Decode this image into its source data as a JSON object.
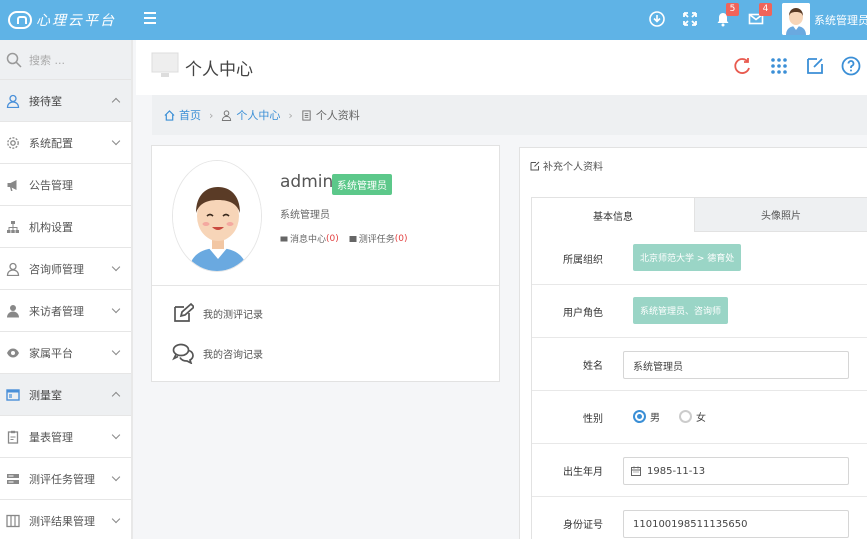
{
  "topbar": {
    "logo_text": "心理云平台",
    "username": "系统管理员",
    "bell_count": "5",
    "mail_count": "4"
  },
  "sidebar": {
    "search_placeholder": "搜索 ...",
    "items": [
      {
        "label": "接待室",
        "icon": "user-outline-icon",
        "group": true,
        "chevron": "up"
      },
      {
        "label": "系统配置",
        "icon": "gear-icon",
        "group": false,
        "chevron": "down"
      },
      {
        "label": "公告管理",
        "icon": "megaphone-icon",
        "group": false,
        "chevron": ""
      },
      {
        "label": "机构设置",
        "icon": "org-chart-icon",
        "group": false,
        "chevron": ""
      },
      {
        "label": "咨询师管理",
        "icon": "user-outline-icon",
        "group": false,
        "chevron": "down"
      },
      {
        "label": "来访者管理",
        "icon": "user-solid-icon",
        "group": false,
        "chevron": "down"
      },
      {
        "label": "家属平台",
        "icon": "eye-icon",
        "group": false,
        "chevron": "down"
      },
      {
        "label": "测量室",
        "icon": "window-icon",
        "group": true,
        "chevron": "up"
      },
      {
        "label": "量表管理",
        "icon": "clipboard-icon",
        "group": false,
        "chevron": "down"
      },
      {
        "label": "测评任务管理",
        "icon": "server-icon",
        "group": false,
        "chevron": "down"
      },
      {
        "label": "测评结果管理",
        "icon": "columns-icon",
        "group": false,
        "chevron": "down"
      }
    ]
  },
  "page": {
    "title": "个人中心"
  },
  "breadcrumb": {
    "home": "首页",
    "center": "个人中心",
    "current": "个人资料"
  },
  "profile": {
    "username": "admin",
    "role_badge": "系统管理员",
    "role_text": "系统管理员",
    "message_label": "消息中心",
    "message_count": "(0)",
    "task_label": "测评任务",
    "task_count": "(0)",
    "record_assess": "我的测评记录",
    "record_consult": "我的咨询记录"
  },
  "panel": {
    "heading": "补充个人资料",
    "tab_basic": "基本信息",
    "tab_photo": "头像照片",
    "fields": {
      "org_label": "所属组织",
      "org_value": "北京师范大学 > 德育处",
      "role_label": "用户角色",
      "role_value": "系统管理员、咨询师",
      "name_label": "姓名",
      "name_value": "系统管理员",
      "gender_label": "性别",
      "gender_male": "男",
      "gender_female": "女",
      "birth_label": "出生年月",
      "birth_value": "1985-11-13",
      "id_label": "身份证号",
      "id_value": "110100198511135650"
    }
  },
  "colors": {
    "topbar": "#5fb3e6",
    "accent_blue": "#3b8fd6",
    "badge_red": "#f0645a",
    "role_green": "#5cc88a",
    "tag_teal": "#9ad5c6"
  }
}
